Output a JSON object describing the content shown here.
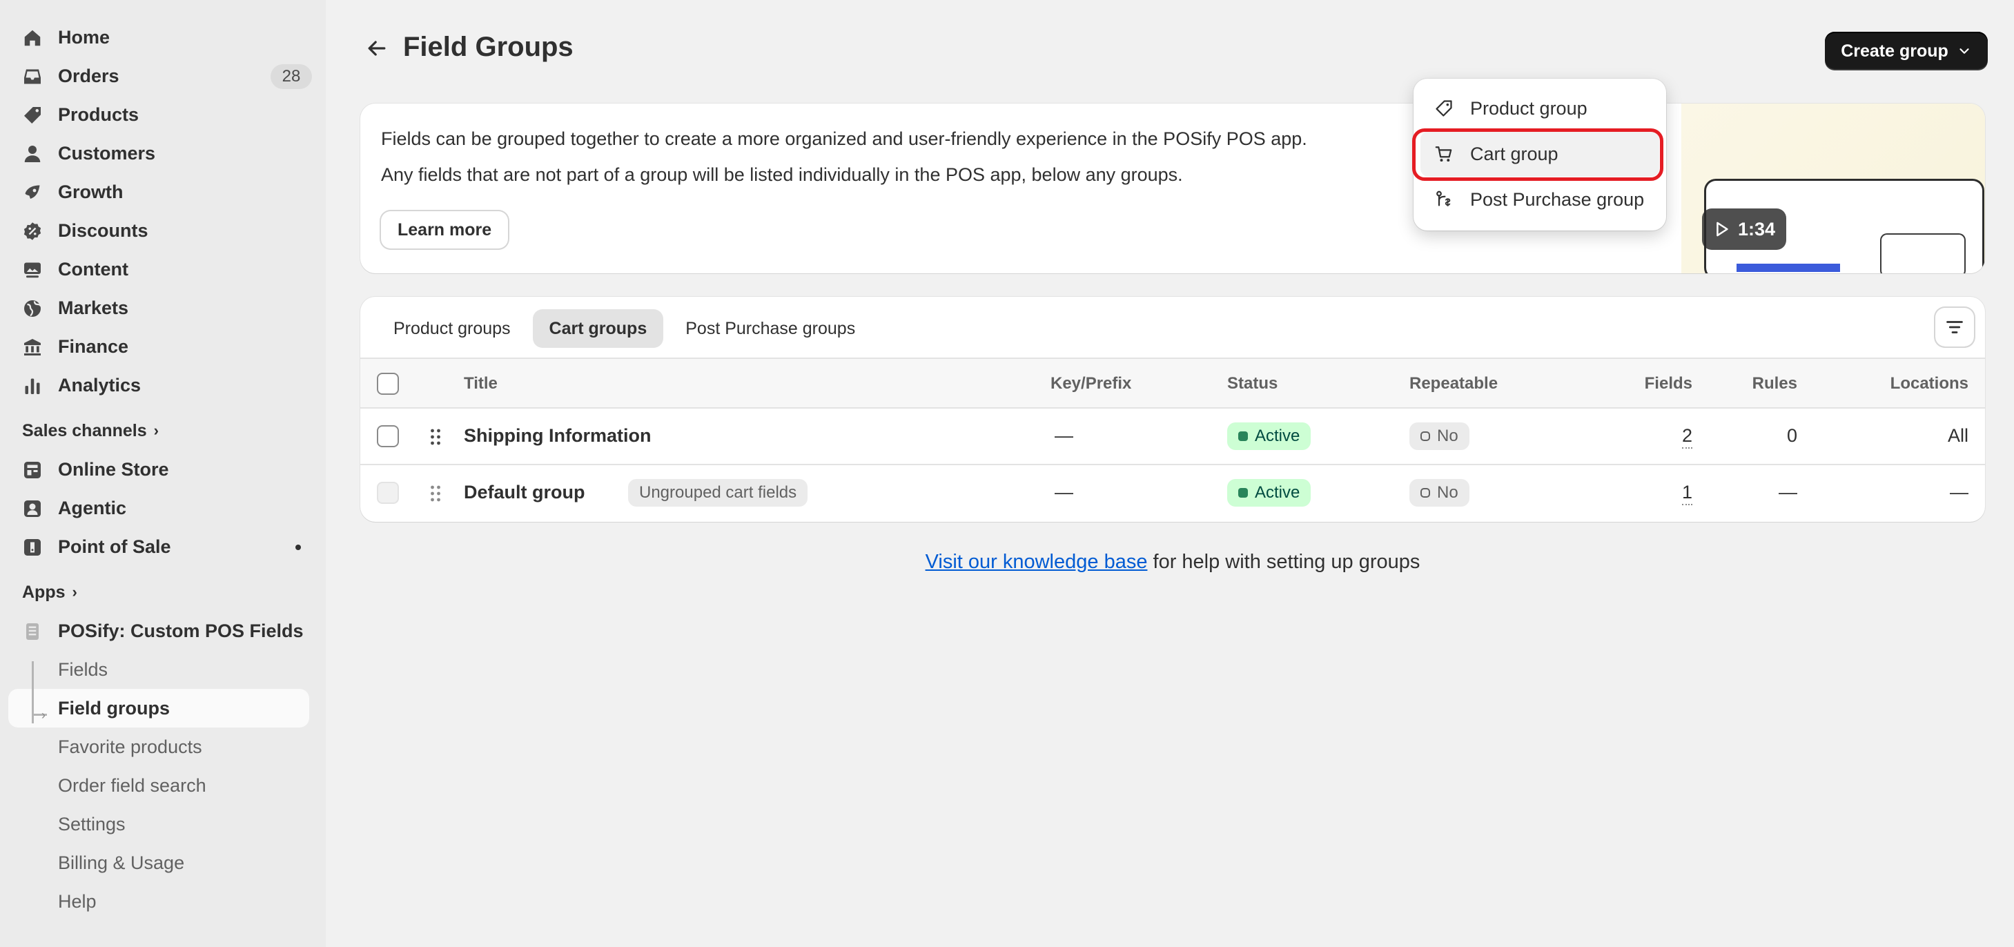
{
  "sidebar": {
    "nav": [
      {
        "label": "Home",
        "icon": "home-icon"
      },
      {
        "label": "Orders",
        "icon": "inbox-icon",
        "badge": "28"
      },
      {
        "label": "Products",
        "icon": "tag-icon"
      },
      {
        "label": "Customers",
        "icon": "person-icon"
      },
      {
        "label": "Growth",
        "icon": "growth-icon"
      },
      {
        "label": "Discounts",
        "icon": "discount-icon"
      },
      {
        "label": "Content",
        "icon": "content-icon"
      },
      {
        "label": "Markets",
        "icon": "globe-icon"
      },
      {
        "label": "Finance",
        "icon": "bank-icon"
      },
      {
        "label": "Analytics",
        "icon": "chart-icon"
      }
    ],
    "sales_channels_heading": "Sales channels",
    "channels": [
      {
        "label": "Online Store",
        "icon": "store-icon"
      },
      {
        "label": "Agentic",
        "icon": "agent-icon"
      },
      {
        "label": "Point of Sale",
        "icon": "pos-icon"
      }
    ],
    "apps_heading": "Apps",
    "app_name": "POSify: Custom POS Fields",
    "app_items": [
      {
        "label": "Fields"
      },
      {
        "label": "Field groups",
        "active": true
      },
      {
        "label": "Favorite products"
      },
      {
        "label": "Order field search"
      },
      {
        "label": "Settings"
      },
      {
        "label": "Billing & Usage"
      },
      {
        "label": "Help"
      }
    ]
  },
  "header": {
    "title": "Field Groups",
    "create_button": "Create group"
  },
  "dropdown": {
    "items": [
      {
        "label": "Product group",
        "icon": "tag-icon"
      },
      {
        "label": "Cart group",
        "icon": "cart-icon"
      },
      {
        "label": "Post Purchase group",
        "icon": "flow-icon"
      }
    ]
  },
  "banner": {
    "line1": "Fields can be grouped together to create a more organized and user-friendly experience in the POSify POS app.",
    "line2": "Any fields that are not part of a group will be listed individually in the POS app, below any groups.",
    "learn_more": "Learn more",
    "video_duration": "1:34"
  },
  "tabs": [
    {
      "label": "Product groups"
    },
    {
      "label": "Cart groups",
      "active": true
    },
    {
      "label": "Post Purchase groups"
    }
  ],
  "table": {
    "columns": {
      "title": "Title",
      "key": "Key/Prefix",
      "status": "Status",
      "repeatable": "Repeatable",
      "fields": "Fields",
      "rules": "Rules",
      "locations": "Locations"
    },
    "rows": [
      {
        "title": "Shipping Information",
        "tag": "",
        "key": "—",
        "status": "Active",
        "repeatable": "No",
        "fields": "2",
        "rules": "0",
        "locations": "All"
      },
      {
        "title": "Default group",
        "tag": "Ungrouped cart fields",
        "key": "—",
        "status": "Active",
        "repeatable": "No",
        "fields": "1",
        "rules": "—",
        "locations": "—"
      }
    ]
  },
  "help": {
    "link": "Visit our knowledge base",
    "rest": " for help with setting up groups"
  },
  "colors": {
    "accent_dark": "#1a1a1a",
    "status_active_bg": "#cdfed4",
    "highlight_red": "#e51c23",
    "link": "#005bd3"
  }
}
